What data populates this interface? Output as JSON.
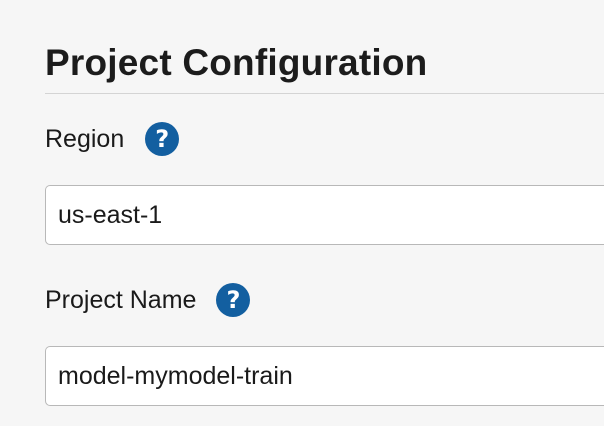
{
  "section": {
    "title": "Project Configuration"
  },
  "fields": {
    "region": {
      "label": "Region",
      "value": "us-east-1",
      "help_icon": "question-circle-icon"
    },
    "project_name": {
      "label": "Project Name",
      "value": "model-mymodel-train",
      "help_icon": "question-circle-icon"
    }
  },
  "icons": {
    "help_glyph": "?"
  },
  "colors": {
    "help_icon_bg": "#135fa0",
    "page_bg": "#f6f6f6",
    "input_border": "#b8b8b8"
  }
}
